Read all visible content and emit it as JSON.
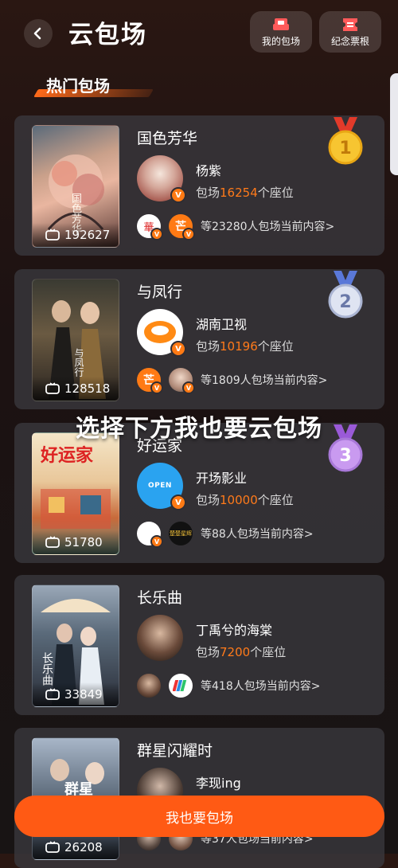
{
  "header": {
    "title": "云包场",
    "my_label": "我的包场",
    "souvenir_label": "纪念票根"
  },
  "section": {
    "title": "热门包场"
  },
  "cards": [
    {
      "rank": "1",
      "title": "国色芳华",
      "views": "192627",
      "host": "杨紫",
      "seats_prefix": "包场",
      "seats": "16254",
      "seats_suffix": "个座位",
      "others": "等23280人包场当前内容>",
      "poster_text": "国色芳华"
    },
    {
      "rank": "2",
      "title": "与凤行",
      "views": "128518",
      "host": "湖南卫视",
      "seats_prefix": "包场",
      "seats": "10196",
      "seats_suffix": "个座位",
      "others": "等1809人包场当前内容>",
      "poster_text": "与凤行"
    },
    {
      "rank": "3",
      "title": "好运家",
      "views": "51780",
      "host": "开场影业",
      "seats_prefix": "包场",
      "seats": "10000",
      "seats_suffix": "个座位",
      "others": "等88人包场当前内容>",
      "poster_text": "好运家"
    },
    {
      "title": "长乐曲",
      "views": "33849",
      "host": "丁禹兮的海棠",
      "seats_prefix": "包场",
      "seats": "7200",
      "seats_suffix": "个座位",
      "others": "等418人包场当前内容>",
      "poster_text": "长乐曲"
    },
    {
      "title": "群星闪耀时",
      "views": "26208",
      "host": "李现ing",
      "others": "等37人包场当前内容>",
      "poster_text": "群星"
    }
  ],
  "logos": {
    "hunan": "芒",
    "open": "OPEN",
    "chuchu": "楚楚星辉",
    "mini_red": "華"
  },
  "overlay": {
    "text": "选择下方我也要云包场"
  },
  "cta": {
    "label": "我也要包场"
  },
  "colors": {
    "accent": "#ff5a14",
    "seat_number": "#ff7a1a"
  }
}
